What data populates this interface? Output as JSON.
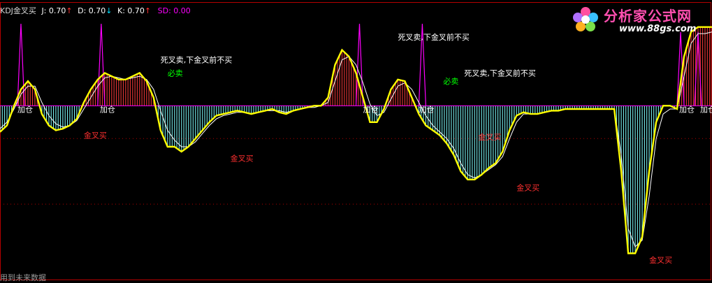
{
  "header": {
    "indicator": "KDJ金叉买",
    "j_label": "J: 0.70",
    "d_label": "D: 0.70",
    "k_label": "K: 0.70",
    "sd_label": "SD: 0.00",
    "arrow_up": "↑",
    "arrow_down": "↓"
  },
  "logo": {
    "name": "分析家公式网",
    "url": "www.88gs.com"
  },
  "footer": {
    "note": "用到未来数据"
  },
  "colors": {
    "background": "#000000",
    "baseline": "#ff00ff",
    "j_line": "#ffff00",
    "k_line": "#ffffff",
    "bar_up": "#ff3c3c",
    "bar_down": "#7fffff",
    "spike": "#ff00ff",
    "grid": "#b30000",
    "label_white": "#ffffff",
    "label_red": "#ff3030",
    "label_green": "#00ff00"
  },
  "chart_data": {
    "type": "line",
    "xlim": [
      0,
      102
    ],
    "ylim": [
      -100,
      50
    ],
    "x": [
      0,
      1,
      2,
      3,
      4,
      5,
      6,
      7,
      8,
      9,
      10,
      11,
      12,
      13,
      14,
      15,
      16,
      17,
      18,
      19,
      20,
      21,
      22,
      23,
      24,
      25,
      26,
      27,
      28,
      29,
      30,
      31,
      32,
      33,
      34,
      35,
      36,
      37,
      38,
      39,
      40,
      41,
      42,
      43,
      44,
      45,
      46,
      47,
      48,
      49,
      50,
      51,
      52,
      53,
      54,
      55,
      56,
      57,
      58,
      59,
      60,
      61,
      62,
      63,
      64,
      65,
      66,
      67,
      68,
      69,
      70,
      71,
      72,
      73,
      74,
      75,
      76,
      77,
      78,
      79,
      80,
      81,
      82,
      83,
      84,
      85,
      86,
      87,
      88,
      89,
      90,
      91,
      92,
      93,
      94,
      95,
      96,
      97,
      98,
      99,
      100,
      101,
      102
    ],
    "series": [
      {
        "key": "j",
        "values": [
          -16,
          -12,
          0,
          10,
          15,
          10,
          -5,
          -12,
          -15,
          -14,
          -12,
          -8,
          2,
          10,
          16,
          20,
          18,
          16,
          16,
          18,
          20,
          15,
          5,
          -15,
          -25,
          -25,
          -28,
          -25,
          -20,
          -15,
          -10,
          -6,
          -5,
          -4,
          -3,
          -4,
          -5,
          -4,
          -3,
          -2,
          -4,
          -5,
          -3,
          -2,
          -1,
          0,
          0,
          5,
          25,
          34,
          30,
          20,
          5,
          -10,
          -10,
          -2,
          10,
          16,
          15,
          5,
          -5,
          -12,
          -15,
          -18,
          -23,
          -30,
          -40,
          -45,
          -45,
          -42,
          -38,
          -35,
          -28,
          -15,
          -6,
          -4,
          -5,
          -5,
          -4,
          -3,
          -3,
          -2,
          -2,
          -2,
          -2,
          -2,
          -2,
          -2,
          -2,
          -40,
          -90,
          -90,
          -80,
          -40,
          -10,
          0,
          0,
          -2,
          30,
          45,
          48,
          48,
          48
        ]
      },
      {
        "key": "k",
        "values": [
          -14,
          -10,
          -2,
          7,
          12,
          12,
          2,
          -6,
          -11,
          -13,
          -12,
          -9,
          -2,
          5,
          12,
          17,
          18,
          17,
          16,
          17,
          18,
          16,
          10,
          -3,
          -15,
          -21,
          -25,
          -25,
          -22,
          -17,
          -12,
          -8,
          -6,
          -5,
          -4,
          -4,
          -5,
          -4,
          -3,
          -3,
          -3,
          -4,
          -3,
          -2,
          -1,
          -1,
          0,
          2,
          15,
          28,
          30,
          25,
          14,
          1,
          -6,
          -4,
          4,
          12,
          14,
          10,
          2,
          -6,
          -12,
          -16,
          -20,
          -26,
          -35,
          -42,
          -44,
          -42,
          -39,
          -36,
          -31,
          -20,
          -10,
          -5,
          -5,
          -5,
          -4,
          -3,
          -3,
          -2,
          -2,
          -2,
          -2,
          -2,
          -2,
          -2,
          -2,
          -30,
          -75,
          -86,
          -82,
          -55,
          -20,
          -5,
          -2,
          -2,
          18,
          38,
          44,
          44,
          45
        ]
      },
      {
        "key": "sd",
        "values": [
          -14,
          -12,
          0,
          10,
          15,
          10,
          -5,
          -12,
          -15,
          -14,
          -12,
          -8,
          2,
          10,
          16,
          20,
          18,
          16,
          16,
          18,
          20,
          15,
          5,
          -15,
          -25,
          -25,
          -28,
          -25,
          -20,
          -15,
          -10,
          -6,
          -5,
          -4,
          -3,
          -4,
          -5,
          -4,
          -3,
          -2,
          -4,
          -5,
          -3,
          -2,
          -1,
          0,
          0,
          5,
          25,
          34,
          30,
          20,
          5,
          -10,
          -10,
          -2,
          10,
          16,
          15,
          5,
          -5,
          -12,
          -15,
          -18,
          -23,
          -30,
          -40,
          -45,
          -45,
          -42,
          -38,
          -35,
          -28,
          -15,
          -6,
          -4,
          -5,
          -5,
          -4,
          -3,
          -3,
          -2,
          -2,
          -2,
          -2,
          -2,
          -2,
          -2,
          -2,
          -40,
          -90,
          -90,
          -80,
          -40,
          -10,
          0,
          0,
          -2,
          30,
          45,
          48,
          48,
          48
        ]
      }
    ],
    "spikes": [
      {
        "x": 3,
        "value": 50
      },
      {
        "x": 14.5,
        "value": 50
      },
      {
        "x": 51.5,
        "value": 50
      },
      {
        "x": 60.5,
        "value": 50
      },
      {
        "x": 97.5,
        "value": 45
      },
      {
        "x": 100,
        "value": 45
      }
    ],
    "annotations": [
      {
        "x": 2.5,
        "y": 0,
        "text": "加仓",
        "kind": "white"
      },
      {
        "x": 14.3,
        "y": 0,
        "text": "加仓",
        "kind": "white"
      },
      {
        "x": 52,
        "y": 0,
        "text": "加仓",
        "kind": "white"
      },
      {
        "x": 60,
        "y": 0,
        "text": "加仓",
        "kind": "white"
      },
      {
        "x": 97.3,
        "y": 0,
        "text": "加仓",
        "kind": "white"
      },
      {
        "x": 100.3,
        "y": 0,
        "text": "加仓",
        "kind": "white"
      },
      {
        "x": 23,
        "y": 28,
        "text": "死叉卖,下金叉前不买",
        "kind": "white"
      },
      {
        "x": 57,
        "y": 42,
        "text": "死叉卖,下金叉前不买",
        "kind": "white"
      },
      {
        "x": 66.5,
        "y": 20,
        "text": "死叉卖,下金叉前不买",
        "kind": "white"
      },
      {
        "x": 24,
        "y": 20,
        "text": "必卖",
        "kind": "green"
      },
      {
        "x": 63.5,
        "y": 15,
        "text": "必卖",
        "kind": "green"
      },
      {
        "x": 12,
        "y": -18,
        "text": "金叉买",
        "kind": "red"
      },
      {
        "x": 33,
        "y": -32,
        "text": "金叉买",
        "kind": "red"
      },
      {
        "x": 68.5,
        "y": -19,
        "text": "金叉买",
        "kind": "red"
      },
      {
        "x": 74,
        "y": -50,
        "text": "金叉买",
        "kind": "red"
      },
      {
        "x": 93,
        "y": -94,
        "text": "金叉买",
        "kind": "red"
      }
    ]
  }
}
